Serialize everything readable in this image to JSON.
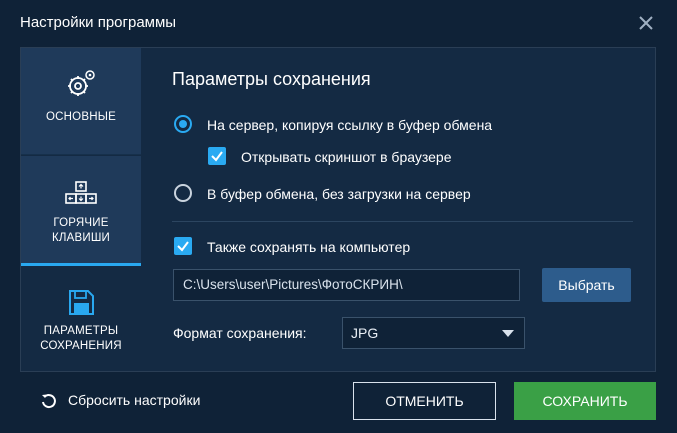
{
  "window": {
    "title": "Настройки программы"
  },
  "sidebar": {
    "items": [
      {
        "label": "ОСНОВНЫЕ",
        "icon": "gear-icon"
      },
      {
        "label_line1": "ГОРЯЧИЕ",
        "label_line2": "КЛАВИШИ",
        "icon": "keyboard-icon"
      },
      {
        "label_line1": "ПАРАМЕТРЫ",
        "label_line2": "СОХРАНЕНИЯ",
        "icon": "floppy-disk-icon",
        "active": true
      }
    ]
  },
  "save_settings": {
    "title": "Параметры сохранения",
    "options": {
      "to_server": {
        "label": "На сервер, копируя ссылку в буфер обмена",
        "selected": true
      },
      "open_in_browser": {
        "label": "Открывать скриншот в браузере",
        "checked": true
      },
      "to_clipboard": {
        "label": "В буфер обмена, без загрузки на сервер",
        "selected": false
      },
      "save_to_computer": {
        "label": "Также сохранять на компьютер",
        "checked": true
      }
    },
    "path": {
      "value": "C:\\Users\\user\\Pictures\\ФотоСКРИН\\"
    },
    "browse_label": "Выбрать",
    "format": {
      "label": "Формат сохранения:",
      "value": "JPG"
    }
  },
  "footer": {
    "reset_label": "Сбросить настройки",
    "cancel_label": "ОТМЕНИТЬ",
    "save_label": "СОХРАНИТЬ"
  },
  "colors": {
    "background": "#0f2237",
    "panel": "#142a43",
    "accent": "#2aaaf2",
    "save_button": "#3aa046",
    "browse_button": "#2d5c8c"
  }
}
